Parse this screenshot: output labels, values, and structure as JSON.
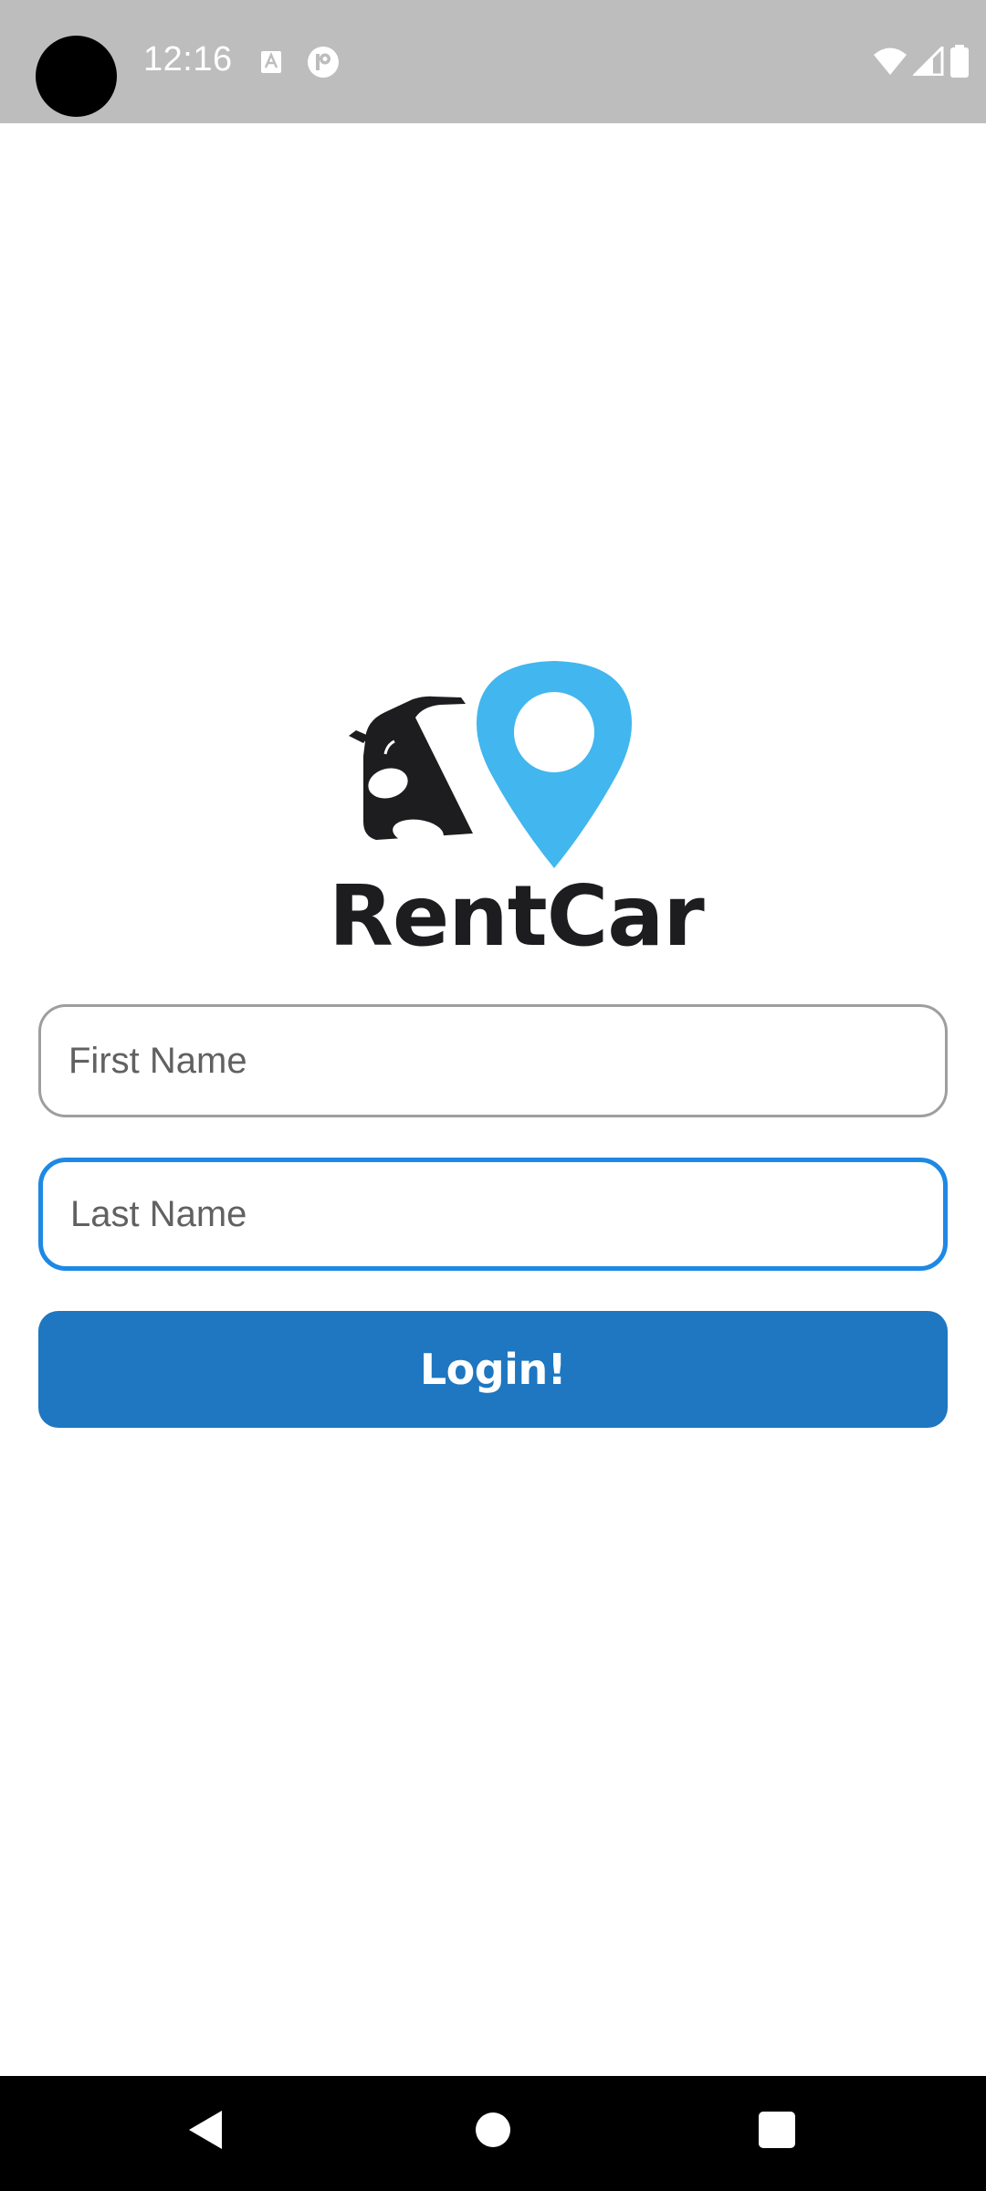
{
  "status_bar": {
    "time": "12:16",
    "icons": [
      "text-a-icon",
      "p-badge-icon",
      "wifi-icon",
      "cellular-signal-icon",
      "battery-icon"
    ]
  },
  "logo": {
    "brand_name": "RentCar",
    "icons": [
      "car-icon",
      "location-pin-icon"
    ],
    "colors": {
      "pin": "#42b6ee",
      "car": "#1d1d1f"
    }
  },
  "form": {
    "first_name_placeholder": "First Name",
    "last_name_placeholder": "Last Name",
    "login_label": "Login!"
  },
  "colors": {
    "status_bar": "#bdbdbd",
    "focus_border": "#1e88e5",
    "button": "#1e77c0",
    "nav_bar": "#000000"
  },
  "nav_bar": {
    "icons": [
      "back-icon",
      "home-icon",
      "recents-icon"
    ]
  }
}
